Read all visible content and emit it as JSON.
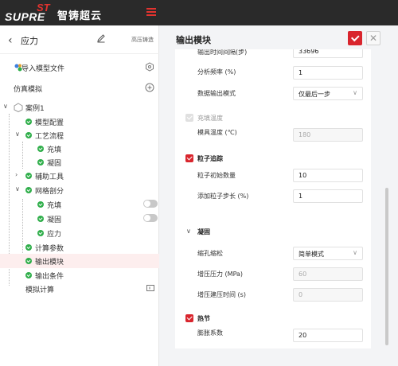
{
  "brand": {
    "name_en": "SUPRE",
    "name_st": "ST",
    "name_cn": "智铸超云"
  },
  "sidebar": {
    "title": "应力",
    "tag": "高压铸造",
    "import_label": "导入模型文件",
    "sim_label": "仿真模拟",
    "tree": {
      "case": "案例1",
      "model_config": "模型配置",
      "process": "工艺流程",
      "fill": "充填",
      "solidify": "凝固",
      "aux_tools": "辅助工具",
      "mesh": "网格剖分",
      "mesh_fill": "充填",
      "mesh_solidify": "凝固",
      "mesh_stress": "应力",
      "calc_params": "计算参数",
      "output_module": "输出模块",
      "output_cond": "输出条件",
      "sim_calc": "模拟计算"
    }
  },
  "panel": {
    "title": "输出模块",
    "fields": {
      "top_partial_label": "输出时间间隔(步)",
      "top_partial_value": "33696",
      "freq_label": "分析频率 (%)",
      "freq_value": "1",
      "mode_label": "数据输出模式",
      "mode_value": "仅最后一步",
      "fill_temp_label": "充填温度",
      "mold_temp_label": "模具温度 (℃)",
      "mold_temp_value": "180",
      "particle_label": "粒子追踪",
      "particle_init_label": "粒子初始数量",
      "particle_init_value": "10",
      "particle_step_label": "添加粒子步长 (%)",
      "particle_step_value": "1",
      "solidify_label": "凝固",
      "shrink_label": "缩孔缩松",
      "shrink_value": "简单模式",
      "pressure_label": "增压压力 (MPa)",
      "pressure_value": "60",
      "pressure_time_label": "增压建压时间 (s)",
      "pressure_time_value": "0",
      "hotspot_label": "热节",
      "expand_label": "膨胀系数",
      "expand_value": "20"
    }
  },
  "colors": {
    "accent": "#d9252d",
    "success": "#2fae4a",
    "topbar": "#2a2a2a"
  }
}
